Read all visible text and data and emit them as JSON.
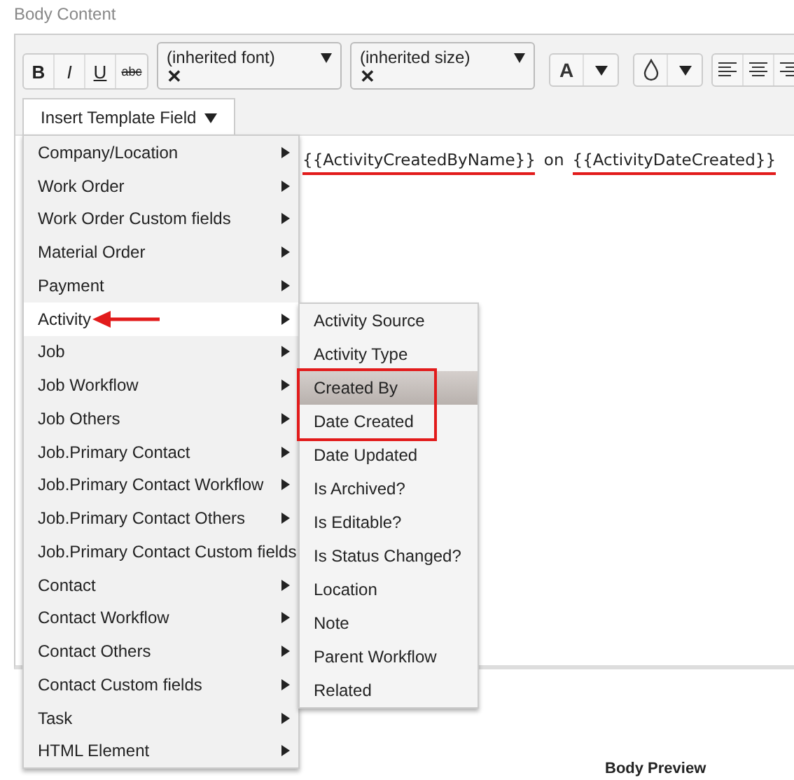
{
  "section_title": "Body Content",
  "toolbar": {
    "format_buttons": [
      {
        "label": "B",
        "kind": "bold"
      },
      {
        "label": "I",
        "kind": "italic"
      },
      {
        "label": "U",
        "kind": "underline"
      },
      {
        "label": "abc",
        "kind": "strike"
      }
    ],
    "font_select": {
      "value": "(inherited font)",
      "clear": "✕"
    },
    "size_select": {
      "value": "(inherited size)",
      "clear": "✕"
    },
    "text_color": {
      "label": "A"
    }
  },
  "insert_button": {
    "label": "Insert Template Field"
  },
  "content": [
    {
      "kind": "token",
      "text": "{{ActivityCreatedByName}}"
    },
    {
      "kind": "text",
      "text": "on"
    },
    {
      "kind": "token",
      "text": "{{ActivityDateCreated}}"
    }
  ],
  "menu": {
    "items": [
      {
        "label": "Company/Location",
        "selected": false
      },
      {
        "label": "Work Order",
        "selected": false
      },
      {
        "label": "Work Order Custom fields",
        "selected": false
      },
      {
        "label": "Material Order",
        "selected": false
      },
      {
        "label": "Payment",
        "selected": false
      },
      {
        "label": "Activity",
        "selected": true
      },
      {
        "label": "Job",
        "selected": false
      },
      {
        "label": "Job Workflow",
        "selected": false
      },
      {
        "label": "Job Others",
        "selected": false
      },
      {
        "label": "Job.Primary Contact",
        "selected": false
      },
      {
        "label": "Job.Primary Contact Workflow",
        "selected": false
      },
      {
        "label": "Job.Primary Contact Others",
        "selected": false
      },
      {
        "label": "Job.Primary Contact Custom fields",
        "selected": false
      },
      {
        "label": "Contact",
        "selected": false
      },
      {
        "label": "Contact Workflow",
        "selected": false
      },
      {
        "label": "Contact Others",
        "selected": false
      },
      {
        "label": "Contact Custom fields",
        "selected": false
      },
      {
        "label": "Task",
        "selected": false
      },
      {
        "label": "HTML Element",
        "selected": false
      }
    ]
  },
  "submenu": {
    "items": [
      {
        "label": "Activity Source",
        "selected": false
      },
      {
        "label": "Activity Type",
        "selected": false
      },
      {
        "label": "Created By",
        "selected": true
      },
      {
        "label": "Date Created",
        "selected": false
      },
      {
        "label": "Date Updated",
        "selected": false
      },
      {
        "label": "Is Archived?",
        "selected": false
      },
      {
        "label": "Is Editable?",
        "selected": false
      },
      {
        "label": "Is Status Changed?",
        "selected": false
      },
      {
        "label": "Location",
        "selected": false
      },
      {
        "label": "Note",
        "selected": false
      },
      {
        "label": "Parent Workflow",
        "selected": false
      },
      {
        "label": "Related",
        "selected": false
      }
    ]
  },
  "preview_title": "Body Preview"
}
